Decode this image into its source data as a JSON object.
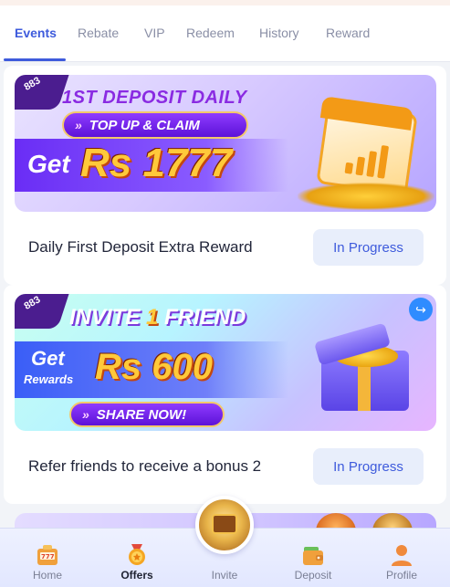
{
  "tabs": [
    {
      "label": "Events",
      "active": true
    },
    {
      "label": "Rebate",
      "active": false
    },
    {
      "label": "VIP",
      "active": false
    },
    {
      "label": "Redeem",
      "active": false
    },
    {
      "label": "History",
      "active": false
    },
    {
      "label": "Reward",
      "active": false
    }
  ],
  "promotions": [
    {
      "badge": "883",
      "banner_headline": "1ST DEPOSIT DAILY",
      "banner_cta": "TOP UP & CLAIM",
      "banner_get": "Get",
      "banner_amount": "Rs 1777",
      "title": "Daily First Deposit Extra Reward",
      "status": "In Progress"
    },
    {
      "badge": "883",
      "banner_headline_prefix": "INVITE",
      "banner_headline_number": "1",
      "banner_headline_suffix": "FRIEND",
      "banner_get": "Get",
      "banner_rewards": "Rewards",
      "banner_amount": "Rs 600",
      "banner_cta": "SHARE NOW!",
      "title": "Refer friends to receive a bonus 2",
      "status": "In Progress"
    }
  ],
  "bottom_nav": [
    {
      "label": "Home",
      "icon": "slot-machine-icon",
      "active": false
    },
    {
      "label": "Offers",
      "icon": "medal-icon",
      "active": true
    },
    {
      "label": "Invite",
      "icon": "treasure-chest-icon",
      "active": false
    },
    {
      "label": "Deposit",
      "icon": "wallet-icon",
      "active": false
    },
    {
      "label": "Profile",
      "icon": "user-icon",
      "active": false
    }
  ],
  "colors": {
    "accent": "#3e5bdc",
    "status_bg": "#e8eefb",
    "amount_gold": "#ffc93a"
  }
}
